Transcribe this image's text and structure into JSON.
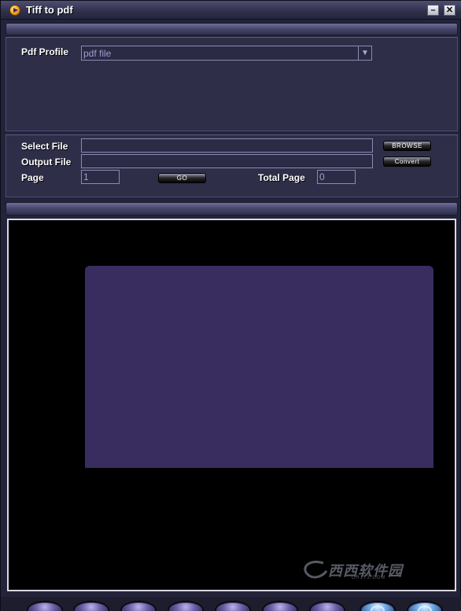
{
  "window": {
    "title": "Tiff to pdf",
    "minimize_glyph": "–",
    "close_glyph": "✕"
  },
  "profile": {
    "label": "Pdf Profile",
    "selected": "pdf file"
  },
  "files": {
    "select_file_label": "Select File",
    "select_file_value": "",
    "output_file_label": "Output File",
    "output_file_value": "",
    "browse_label": "BROWSE",
    "convert_label": "Convert",
    "page_label": "Page",
    "page_value": "1",
    "go_label": "GO",
    "total_page_label": "Total Page",
    "total_page_value": "0"
  },
  "icons": {
    "app": "tiff-to-pdf-app-icon",
    "dropdown": "chevron-down-icon",
    "toolbar": [
      "toolbar-button-1",
      "toolbar-button-2",
      "toolbar-button-3",
      "toolbar-button-4",
      "toolbar-button-5",
      "toolbar-button-6",
      "toolbar-button-7",
      "info-icon",
      "help-icon"
    ]
  },
  "watermark": {
    "text": "西西软件园",
    "sub": "CR173.COM"
  },
  "colors": {
    "background": "#23233a",
    "preview_background": "#000000",
    "page": "#392c5f",
    "accent": "#8b8bb2"
  }
}
